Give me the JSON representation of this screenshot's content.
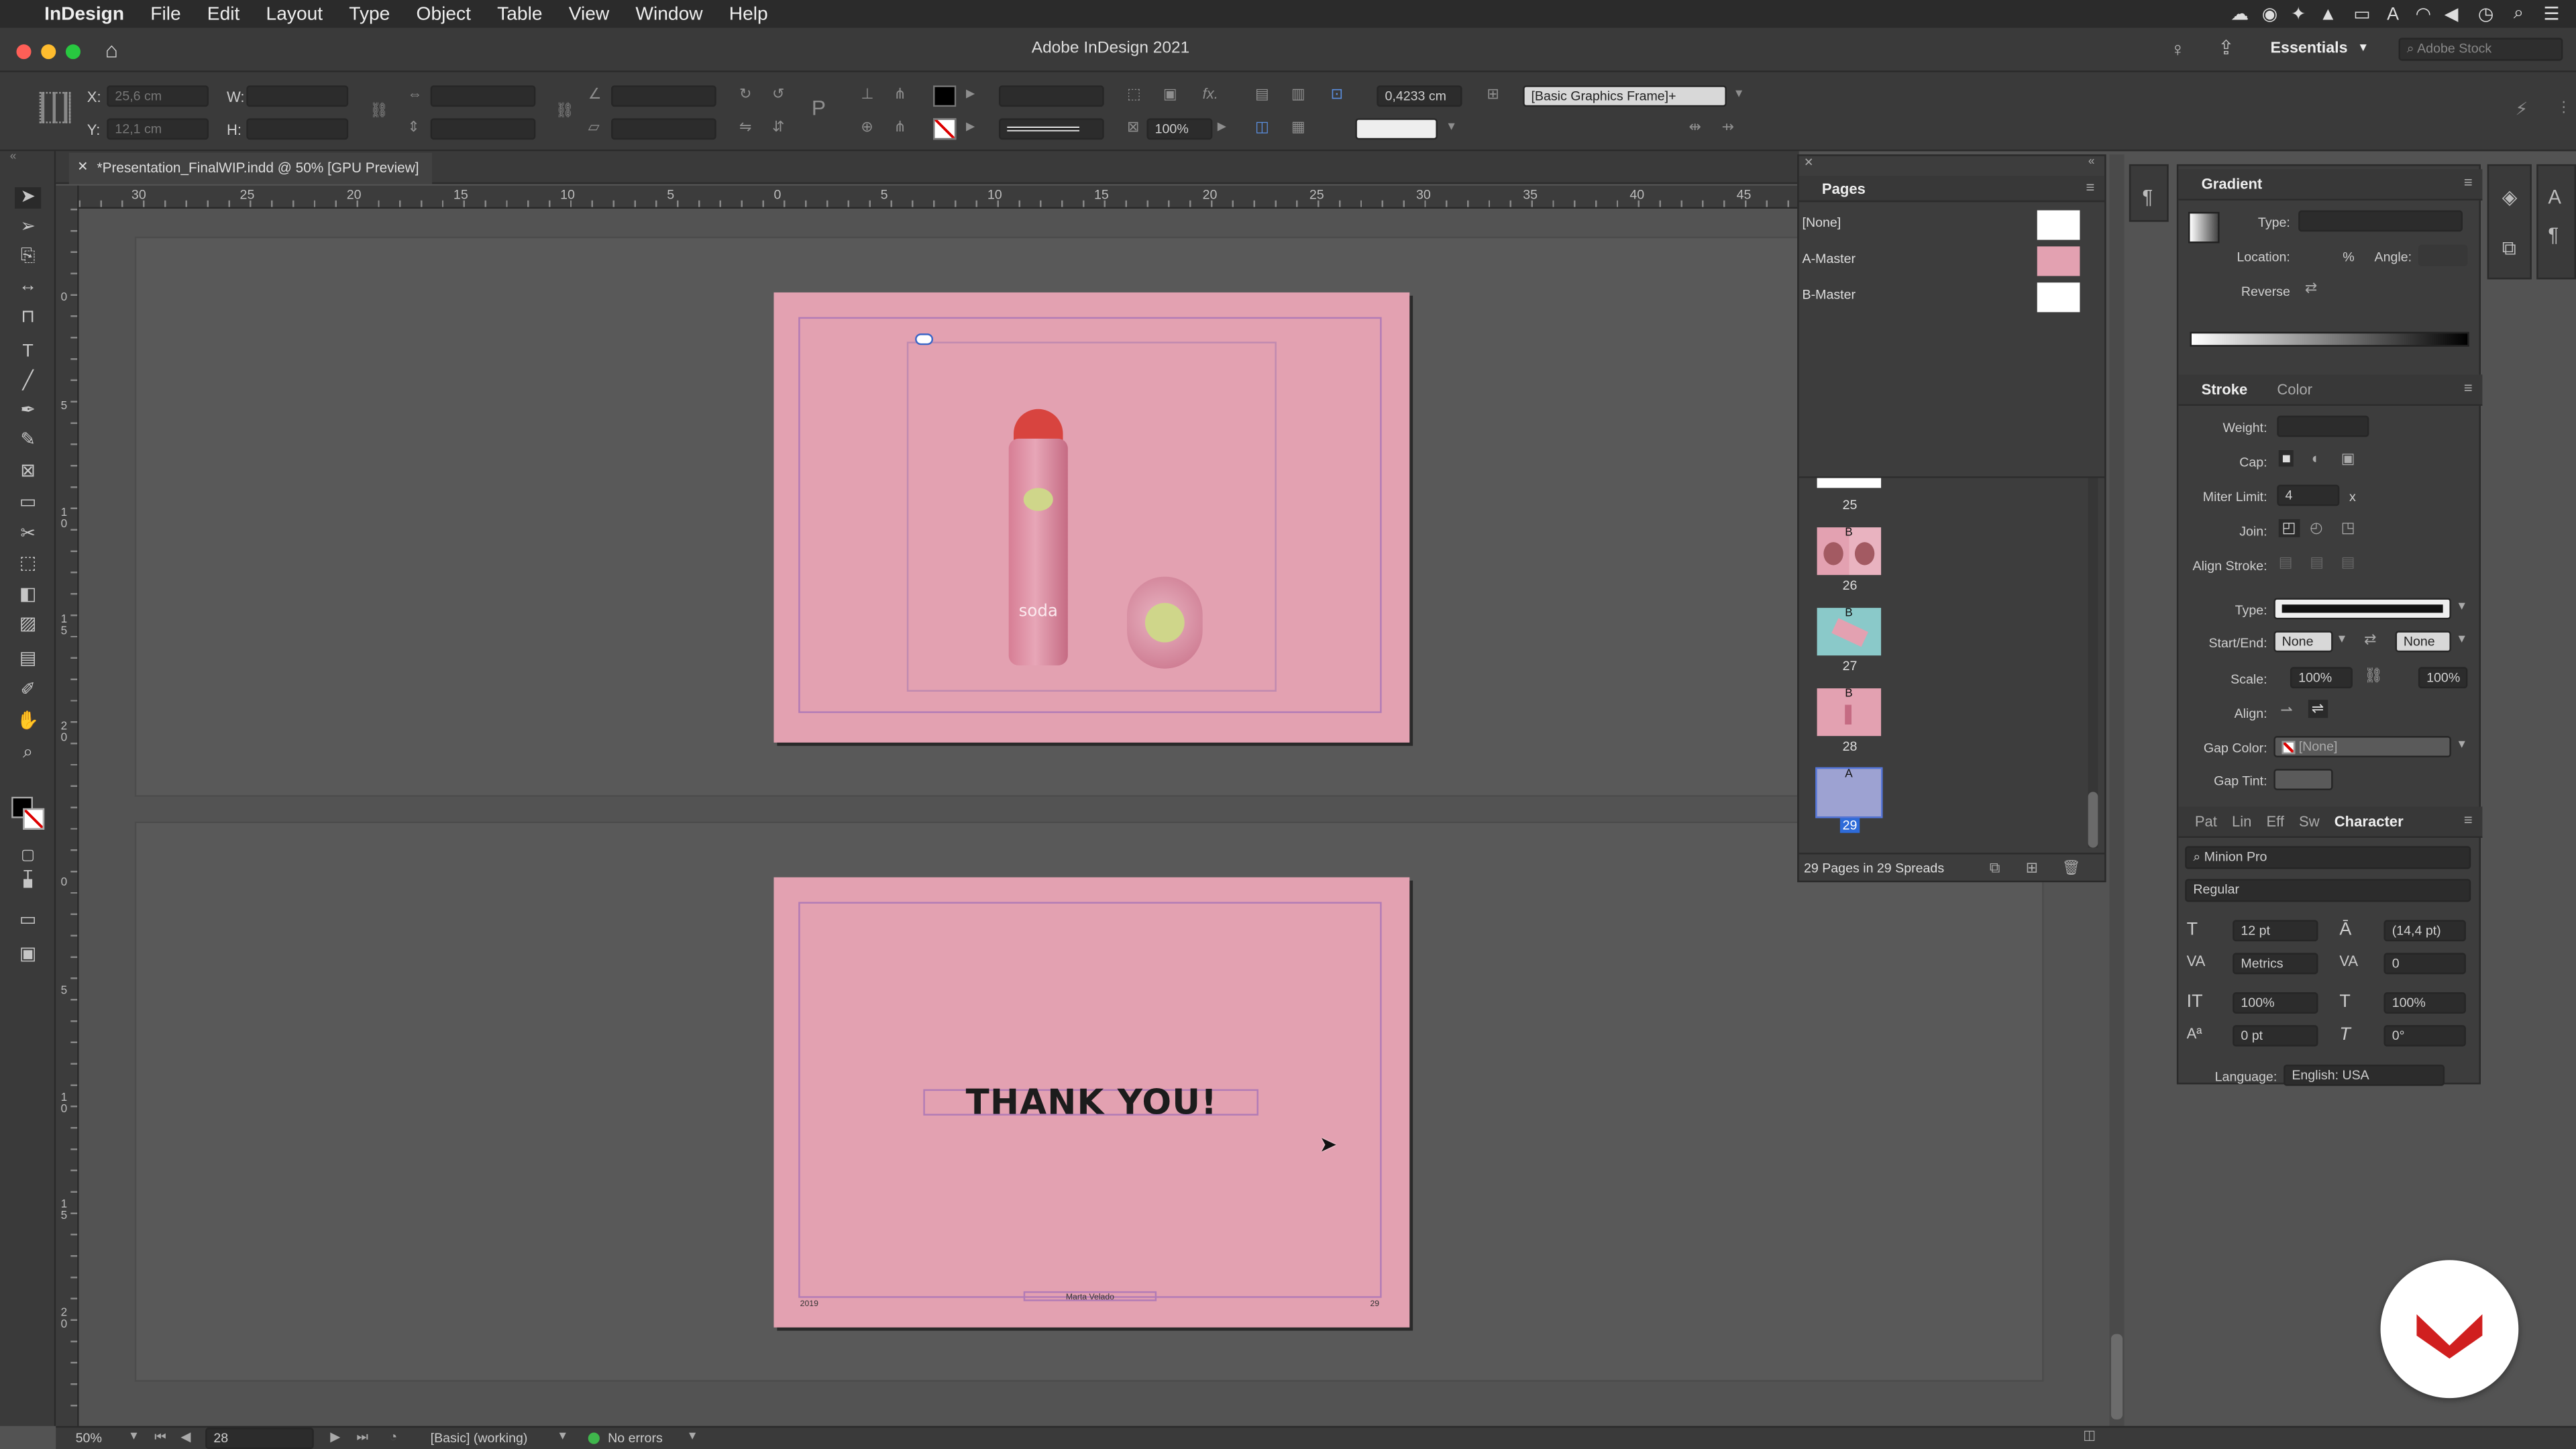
{
  "menubar": {
    "app_name": "InDesign",
    "items": [
      "File",
      "Edit",
      "Layout",
      "Type",
      "Object",
      "Table",
      "View",
      "Window",
      "Help"
    ]
  },
  "titlebar": {
    "window_title": "Adobe InDesign 2021",
    "workspace": "Essentials",
    "stock_search_placeholder": "Adobe Stock"
  },
  "control_bar": {
    "x": "25,6 cm",
    "y": "12,1 cm",
    "x_label": "X:",
    "y_label": "Y:",
    "w_label": "W:",
    "h_label": "H:",
    "scale_percent": "100%",
    "stroke_weight": "0,4233 cm",
    "object_style": "[Basic Graphics Frame]+"
  },
  "document_tab": {
    "title": "*Presentation_FinalWIP.indd @ 50% [GPU Preview]"
  },
  "ruler": {
    "ticks": [
      "30",
      "25",
      "20",
      "15",
      "10",
      "5",
      "0",
      "5",
      "10",
      "15",
      "20",
      "25",
      "30",
      "35",
      "40",
      "45"
    ],
    "vticks_top": [
      "0",
      "5",
      "1\n0",
      "1\n5",
      "2\n0"
    ],
    "vticks_bottom": [
      "0",
      "5",
      "1\n0",
      "1\n5",
      "2\n0"
    ]
  },
  "canvas": {
    "page1_brand": "soda",
    "page2_heading": "THANK YOU!",
    "page2_footer_left": "2019",
    "page2_footer_center": "Marta Velado",
    "page2_footer_right": "29",
    "page_color": "#e3a1b1",
    "margin_color": "#b27bb6"
  },
  "pages_panel": {
    "title": "Pages",
    "masters": [
      {
        "name": "[None]",
        "color": "#ffffff"
      },
      {
        "name": "A-Master",
        "color": "#e3a1b1"
      },
      {
        "name": "B-Master",
        "color": "#ffffff"
      }
    ],
    "pages": [
      {
        "num": "25",
        "master": ""
      },
      {
        "num": "26",
        "master": "B"
      },
      {
        "num": "27",
        "master": "B"
      },
      {
        "num": "28",
        "master": "B"
      },
      {
        "num": "29",
        "master": "A"
      }
    ],
    "summary": "29 Pages in 29 Spreads"
  },
  "gradient_panel": {
    "title": "Gradient",
    "type_label": "Type:",
    "location_label": "Location:",
    "location_unit": "%",
    "angle_label": "Angle:",
    "reverse_label": "Reverse"
  },
  "stroke_panel": {
    "tab_stroke": "Stroke",
    "tab_color": "Color",
    "weight_label": "Weight:",
    "cap_label": "Cap:",
    "miter_label": "Miter Limit:",
    "miter_value": "4",
    "miter_unit": "x",
    "join_label": "Join:",
    "align_label": "Align Stroke:",
    "type_label": "Type:",
    "startend_label": "Start/End:",
    "start_value": "None",
    "end_value": "None",
    "scale_label": "Scale:",
    "scale_start": "100%",
    "scale_end": "100%",
    "align2_label": "Align:",
    "gap_color_label": "Gap Color:",
    "gap_color_value": "[None]",
    "gap_tint_label": "Gap Tint:"
  },
  "character_panel": {
    "tabs": [
      "Pat",
      "Lin",
      "Eff",
      "Sw",
      "Character"
    ],
    "font_family": "Minion Pro",
    "font_style": "Regular",
    "size": "12 pt",
    "leading": "(14,4 pt)",
    "kerning": "Metrics",
    "tracking": "0",
    "vscale": "100%",
    "hscale": "100%",
    "baseline": "0 pt",
    "skew": "0°",
    "language_label": "Language:",
    "language": "English: USA"
  },
  "status_bar": {
    "zoom": "50%",
    "page": "28",
    "profile": "[Basic] (working)",
    "errors": "No errors"
  }
}
